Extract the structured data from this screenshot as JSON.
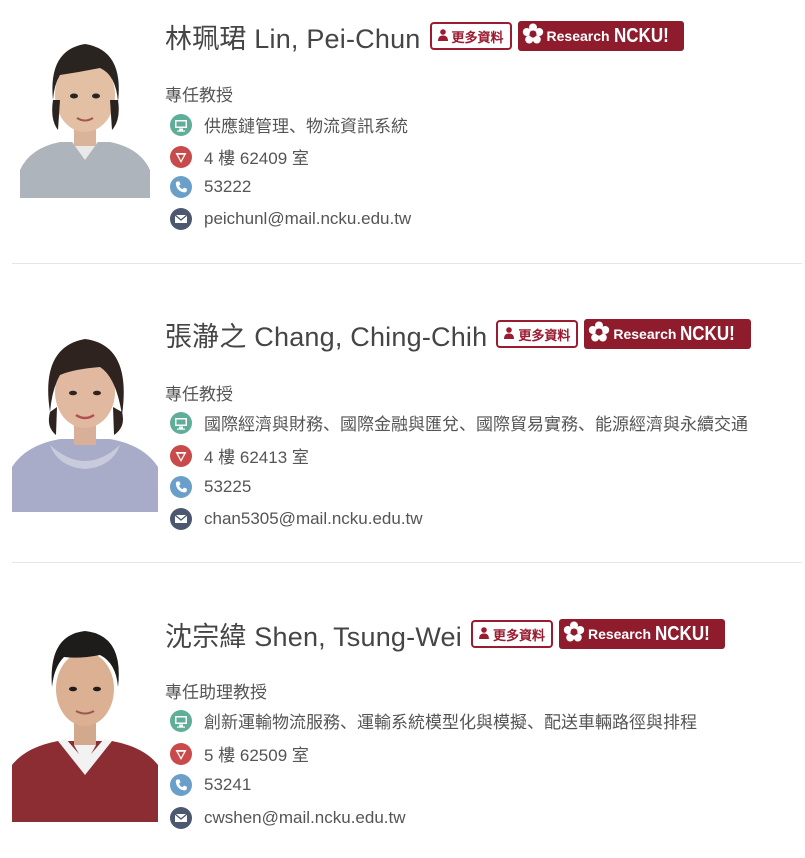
{
  "more_label": "更多資料",
  "research_label": {
    "word": "Research",
    "brand": "NCKU!"
  },
  "colors": {
    "accent": "#9b1b30",
    "research_bg": "#8f1c2c",
    "text": "#555555",
    "name": "#454545"
  },
  "icons": {
    "expertise": "monitor-icon",
    "office": "location-pin-icon",
    "phone": "phone-icon",
    "email": "envelope-icon",
    "more": "person-icon",
    "research": "ncku-emblem-icon"
  },
  "people": [
    {
      "name": "林珮珺 Lin, Pei-Chun",
      "title": "專任教授",
      "expertise": "供應鏈管理、物流資訊系統",
      "office": "4 樓 62409 室",
      "phone": "53222",
      "email": "peichunl@mail.ncku.edu.tw"
    },
    {
      "name": "張瀞之 Chang, Ching-Chih",
      "title": "專任教授",
      "expertise": "國際經濟與財務、國際金融與匯兌、國際貿易實務、能源經濟與永續交通",
      "office": "4 樓 62413 室",
      "phone": "53225",
      "email": "chan5305@mail.ncku.edu.tw"
    },
    {
      "name": "沈宗緯 Shen, Tsung-Wei",
      "title": "專任助理教授",
      "expertise": "創新運輸物流服務、運輸系統模型化與模擬、配送車輛路徑與排程",
      "office": "5 樓 62509 室",
      "phone": "53241",
      "email": "cwshen@mail.ncku.edu.tw"
    }
  ]
}
